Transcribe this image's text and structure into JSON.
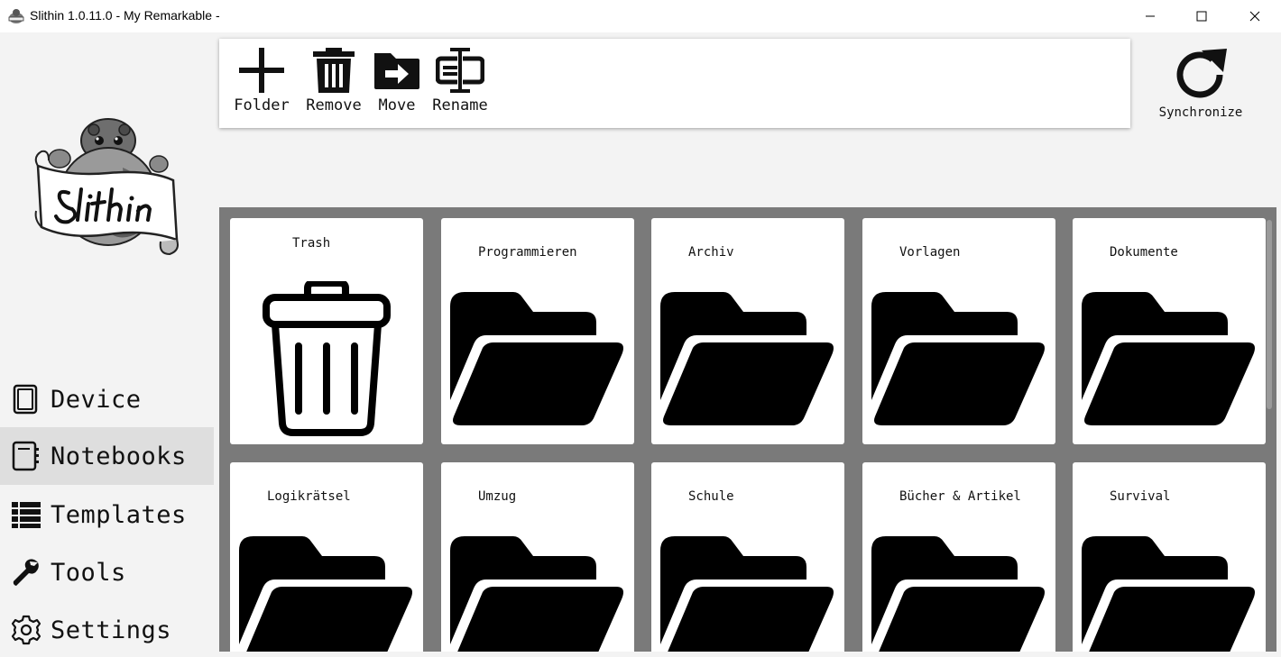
{
  "window": {
    "title": "Slithin 1.0.11.0 - My Remarkable -"
  },
  "sidebar": {
    "items": [
      {
        "label": "Device",
        "icon": "tablet-icon",
        "active": false
      },
      {
        "label": "Notebooks",
        "icon": "notebook-icon",
        "active": true
      },
      {
        "label": "Templates",
        "icon": "list-icon",
        "active": false
      },
      {
        "label": "Tools",
        "icon": "wrench-icon",
        "active": false
      },
      {
        "label": "Settings",
        "icon": "gear-icon",
        "active": false
      }
    ]
  },
  "toolbar": {
    "folder_label": "Folder",
    "remove_label": "Remove",
    "move_label": "Move",
    "rename_label": "Rename"
  },
  "sync": {
    "label": "Synchronize"
  },
  "grid": {
    "items": [
      {
        "title": "Trash",
        "type": "trash"
      },
      {
        "title": "Programmieren",
        "type": "folder"
      },
      {
        "title": "Archiv",
        "type": "folder"
      },
      {
        "title": "Vorlagen",
        "type": "folder"
      },
      {
        "title": "Dokumente",
        "type": "folder"
      },
      {
        "title": "Logikrätsel",
        "type": "folder"
      },
      {
        "title": "Umzug",
        "type": "folder"
      },
      {
        "title": "Schule",
        "type": "folder"
      },
      {
        "title": "Bücher & Artikel",
        "type": "folder"
      },
      {
        "title": "Survival",
        "type": "folder"
      }
    ]
  },
  "colors": {
    "background": "#f3f3f3",
    "grid_background": "#7a7a7a",
    "active_nav": "#dedede"
  }
}
